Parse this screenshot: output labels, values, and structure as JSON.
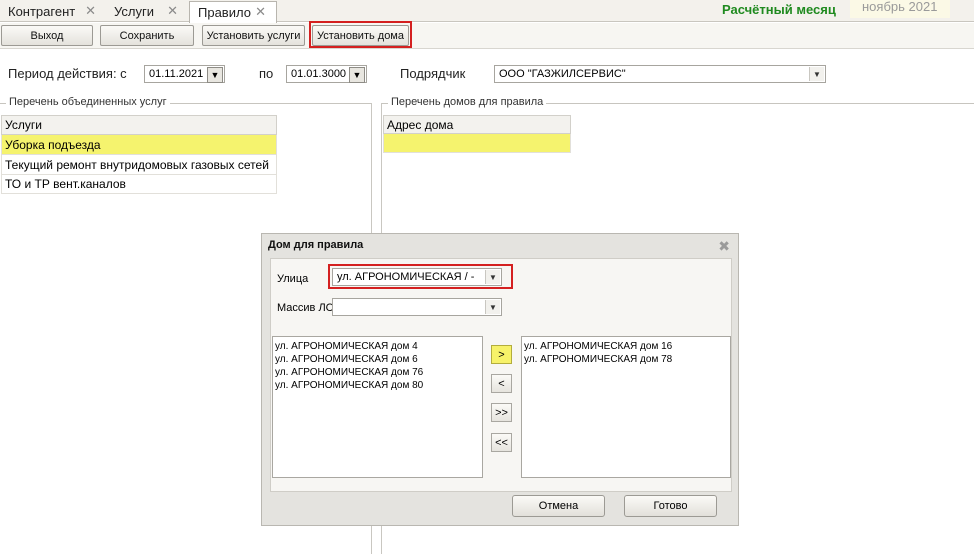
{
  "tabs": [
    {
      "label": "Контрагент"
    },
    {
      "label": "Услуги"
    },
    {
      "label": "Правило"
    }
  ],
  "month": {
    "label": "Расчётный месяц",
    "value": "ноябрь 2021"
  },
  "toolbar": {
    "exit": "Выход",
    "save": "Сохранить",
    "set_services": "Установить услуги",
    "set_houses": "Установить дома"
  },
  "filter": {
    "period_label": "Период действия: с",
    "date_from": "01.11.2021",
    "to_label": "по",
    "date_to": "01.01.3000",
    "contractor_label": "Подрядчик",
    "contractor_value": "ООО \"ГАЗЖИЛСЕРВИС\""
  },
  "services_panel": {
    "title": "Перечень объединенных услуг",
    "header": "Услуги",
    "rows": [
      "Уборка подъезда",
      "Текущий ремонт внутридомовых газовых сетей",
      "ТО и ТР вент.каналов"
    ]
  },
  "houses_panel": {
    "title": "Перечень домов для правила",
    "header": "Адрес дома"
  },
  "dialog": {
    "title": "Дом для правила",
    "street_label": "Улица",
    "street_value": "ул. АГРОНОМИЧЕСКАЯ / -",
    "massiv_label": "Массив ЛС",
    "massiv_value": "",
    "available": [
      "ул. АГРОНОМИЧЕСКАЯ дом 4",
      "ул. АГРОНОМИЧЕСКАЯ дом 6",
      "ул. АГРОНОМИЧЕСКАЯ дом 76",
      "ул. АГРОНОМИЧЕСКАЯ дом 80"
    ],
    "selected": [
      "ул. АГРОНОМИЧЕСКАЯ дом 16",
      "ул. АГРОНОМИЧЕСКАЯ дом 78"
    ],
    "move_right": ">",
    "move_left": "<",
    "move_all_right": ">>",
    "move_all_left": "<<",
    "cancel": "Отмена",
    "done": "Готово"
  }
}
